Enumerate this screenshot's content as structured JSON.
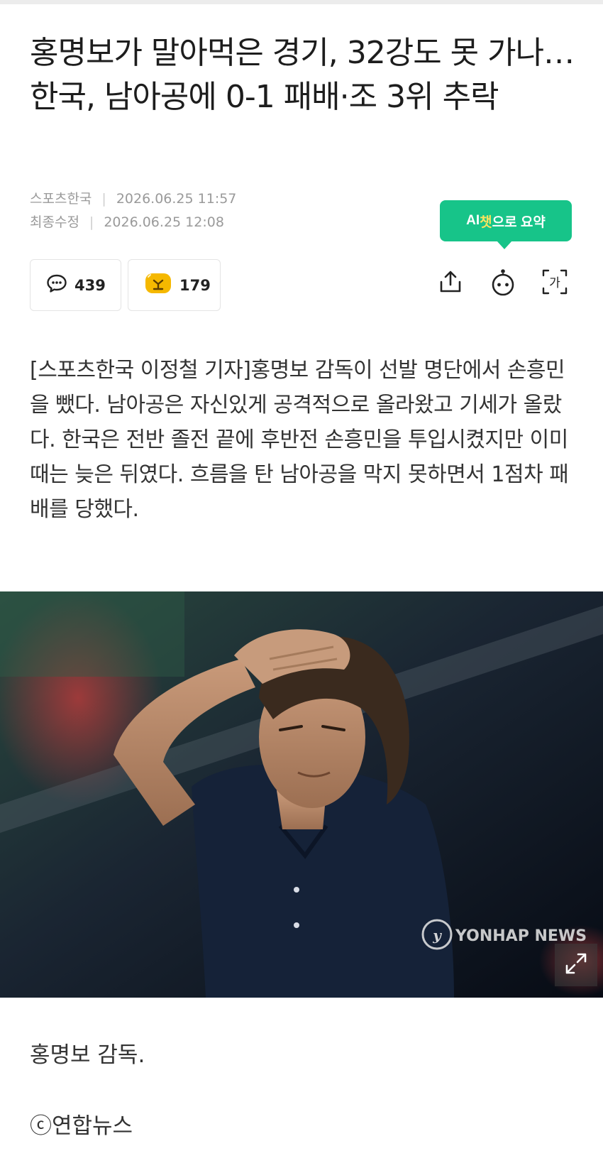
{
  "article": {
    "headline": "홍명보가 말아먹은 경기, 32강도 못 가나…한국, 남아공에 0-1 패배·조 3위 추락",
    "source": "스포츠한국",
    "published": "2026.06.25 11:57",
    "modified_label": "최종수정",
    "modified": "2026.06.25 12:08",
    "body": "[스포츠한국 이정철 기자]홍명보 감독이 선발 명단에서 손흥민을 뺐다. 남아공은 자신있게 공격적으로 올라왔고 기세가 올랐다. 한국은 전반 졸전 끝에 후반전 손흥민을 투입시켰지만 이미 때는 늦은 뒤였다. 흐름을 탄 남아공을 막지 못하면서 1점차 패배를 당했다.",
    "photo_watermark": "YONHAP NEWS",
    "caption": "홍명보 감독.",
    "credit": "ⓒ연합뉴스"
  },
  "ai_summary": {
    "ai": "AI",
    "chat": "챗",
    "rest": "으로 요약"
  },
  "stats": {
    "comments": "439",
    "reactions": "179"
  },
  "icons": {
    "comment": "speech-bubble-icon",
    "reaction": "sticker-icon",
    "share": "share-icon",
    "bot": "chatbot-icon",
    "font": "font-size-icon",
    "expand": "expand-icon"
  },
  "colors": {
    "accent": "#17c489",
    "accent_highlight": "#fbe35e",
    "reaction_badge": "#f5b800"
  }
}
